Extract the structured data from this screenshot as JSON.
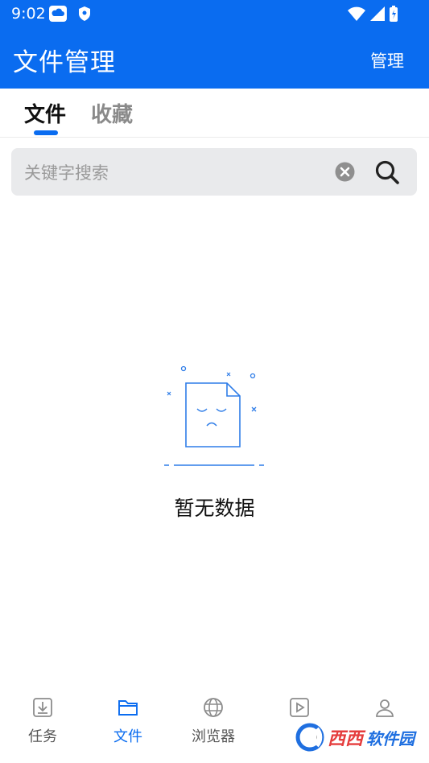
{
  "status_bar": {
    "time": "9:02"
  },
  "app_bar": {
    "title": "文件管理",
    "action": "管理"
  },
  "tabs": [
    {
      "label": "文件"
    },
    {
      "label": "收藏"
    }
  ],
  "search": {
    "placeholder": "关键字搜索",
    "value": ""
  },
  "empty_state": {
    "text": "暂无数据"
  },
  "bottom_nav": [
    {
      "label": "任务",
      "icon": "download-tray-icon"
    },
    {
      "label": "文件",
      "icon": "folder-icon"
    },
    {
      "label": "浏览器",
      "icon": "globe-icon"
    },
    {
      "label": "",
      "icon": "play-icon"
    },
    {
      "label": "",
      "icon": "user-icon"
    }
  ],
  "colors": {
    "primary": "#0a6cf0",
    "text": "#111111",
    "muted": "#8a8a8a",
    "search_bg": "#e9eaec"
  },
  "watermark": {
    "text_red": "西西",
    "text_blue": "软件园"
  }
}
